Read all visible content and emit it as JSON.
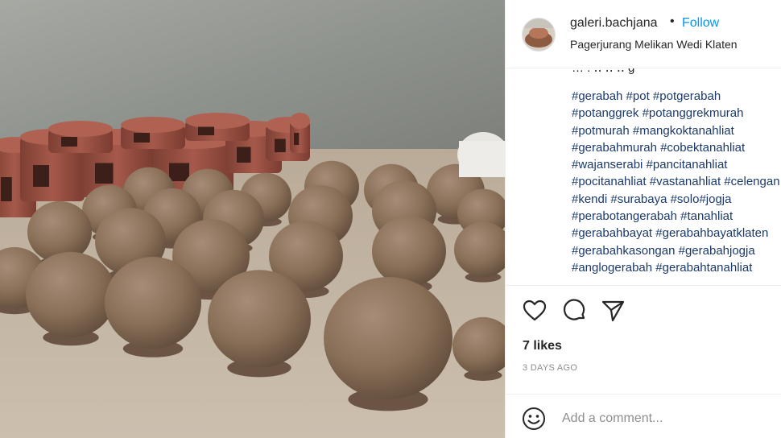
{
  "post": {
    "username": "galeri.bachjana",
    "separator": "•",
    "follow_label": "Follow",
    "location": "Pagerjurang Melikan Wedi Klaten",
    "caption_cut": "… . ‥ ‥ ‥ g",
    "hashtag_lines": [
      "#gerabah #pot #potgerabah",
      "#potanggrek #potanggrekmurah",
      "#potmurah #mangkoktanahliat",
      "#gerabahmurah #cobektanahliat",
      "#wajanserabi #pancitanahliat",
      "#pocitanahliat #vastanahliat #celengan",
      "#kendi #surabaya #solo#jogja",
      "#perabotangerabah #tanahliat",
      "#gerabahbayat #gerabahbayatklaten",
      "#gerabahkasongan #gerabahjogja",
      "#anglogerabah #gerabahtanahliat"
    ],
    "likes": "7 likes",
    "time_ago": "3 DAYS AGO",
    "comment_placeholder": "Add a comment..."
  },
  "icons": {
    "like": "heart-icon",
    "comment": "comment-icon",
    "share": "share-icon",
    "emoji": "emoji-icon"
  },
  "colors": {
    "follow": "#0095f6",
    "hashtag": "#1b3a6b",
    "secondary_text": "#8e8e8e",
    "clay": "#8f7460"
  }
}
